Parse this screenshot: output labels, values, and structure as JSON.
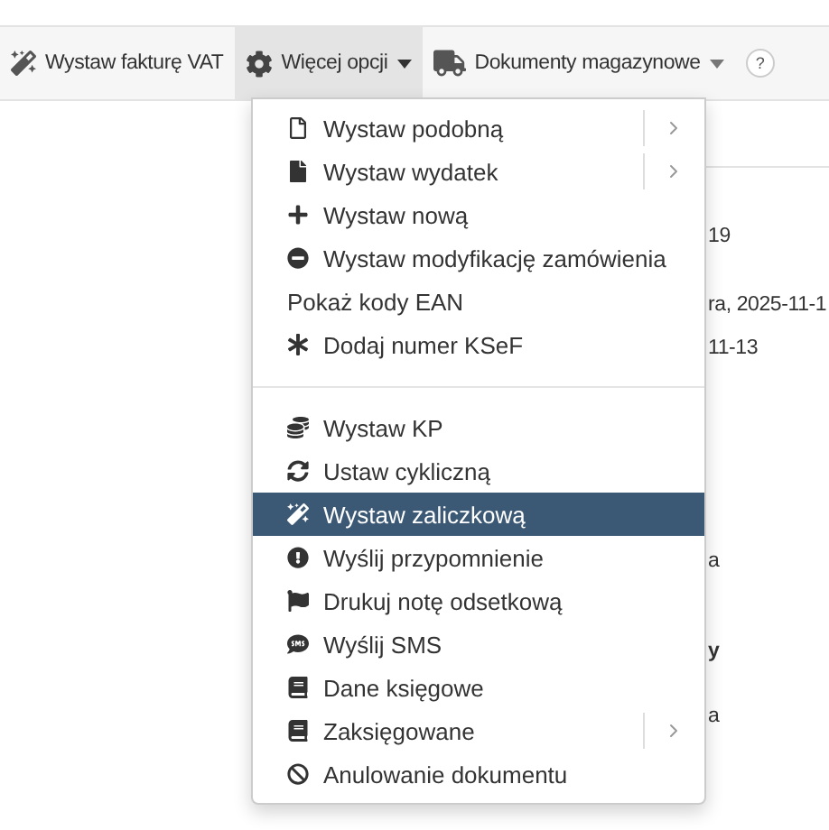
{
  "toolbar": {
    "buttons": [
      {
        "label": "Wystaw fakturę VAT",
        "selected": false,
        "dropdown": false
      },
      {
        "label": "Więcej opcji",
        "selected": true,
        "dropdown": true
      },
      {
        "label": "Dokumenty magazynowe",
        "selected": false,
        "dropdown": true
      }
    ],
    "help": "?"
  },
  "background_texts": [
    "19",
    "ra, 2025-11-1",
    "11-13",
    "a",
    "y",
    "a"
  ],
  "menu": {
    "groups": [
      [
        {
          "label": "Wystaw podobną",
          "submenu": true,
          "selected": false
        },
        {
          "label": "Wystaw wydatek",
          "submenu": true,
          "selected": false
        },
        {
          "label": "Wystaw nową",
          "submenu": false,
          "selected": false
        },
        {
          "label": "Wystaw modyfikację zamówienia",
          "submenu": false,
          "selected": false
        },
        {
          "label": "Pokaż kody EAN",
          "submenu": false,
          "selected": false
        },
        {
          "label": "Dodaj numer KSeF",
          "submenu": false,
          "selected": false
        }
      ],
      [
        {
          "label": "Wystaw KP",
          "submenu": false,
          "selected": false
        },
        {
          "label": "Ustaw cykliczną",
          "submenu": false,
          "selected": false
        },
        {
          "label": "Wystaw zaliczkową",
          "submenu": false,
          "selected": true
        },
        {
          "label": "Wyślij przypomnienie",
          "submenu": false,
          "selected": false
        },
        {
          "label": "Drukuj notę odsetkową",
          "submenu": false,
          "selected": false
        },
        {
          "label": "Wyślij SMS",
          "submenu": false,
          "selected": false
        },
        {
          "label": "Dane księgowe",
          "submenu": false,
          "selected": false
        },
        {
          "label": "Zaksięgowane",
          "submenu": true,
          "selected": false
        },
        {
          "label": "Anulowanie dokumentu",
          "submenu": false,
          "selected": false
        }
      ]
    ]
  }
}
